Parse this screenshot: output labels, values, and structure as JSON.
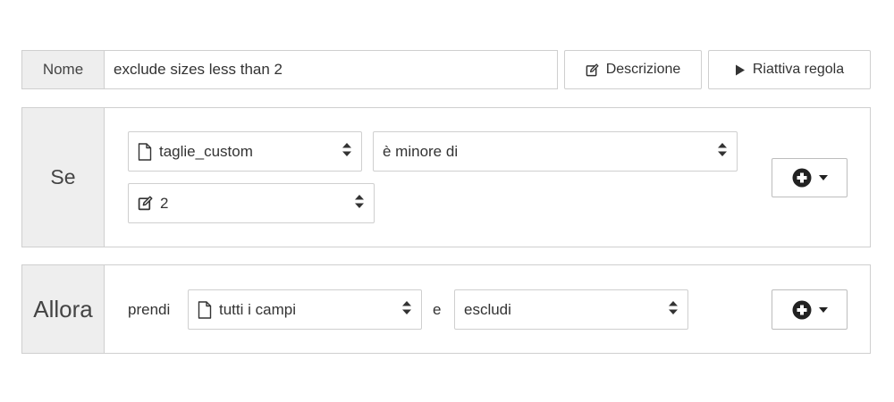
{
  "rule_name": {
    "label": "Nome",
    "value": "exclude sizes less than 2"
  },
  "toolbar": {
    "description_label": "Descrizione",
    "reactivate_label": "Riattiva regola"
  },
  "condition": {
    "label": "Se",
    "field": "taglie_custom",
    "operator": "è minore di",
    "value": "2"
  },
  "action": {
    "label": "Allora",
    "take_text": "prendi",
    "fields": "tutti i campi",
    "conjunction": "e",
    "action": "escludi"
  },
  "icons": {
    "file": "file-icon",
    "edit": "edit-icon",
    "play": "play-icon",
    "plus_circle": "plus-circle-icon",
    "caret_down": "caret-down-icon",
    "sort": "sort-icon"
  }
}
